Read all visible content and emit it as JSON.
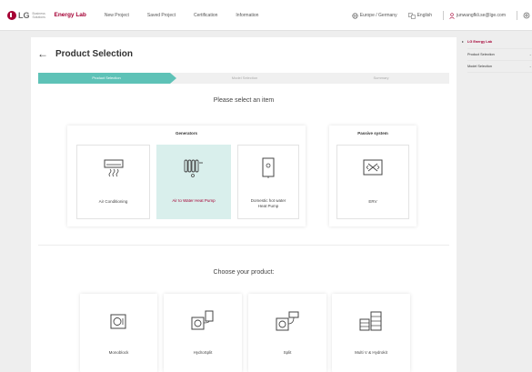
{
  "nav": {
    "logo_text": "LG",
    "logo_sub": "Business Solutions",
    "brand": "Energy Lab",
    "items": [
      "New Project",
      "Saved Project",
      "Certification",
      "Information"
    ],
    "region": "Europe / Germany",
    "language": "English",
    "user": "junwangfkli.se@lge.com"
  },
  "page": {
    "title": "Product Selection",
    "steps": [
      "Product Selection",
      "Model Selection",
      "Summary"
    ]
  },
  "select_item": {
    "heading": "Please select an item",
    "generators_title": "Generators",
    "passive_title": "Passive system",
    "generators": [
      {
        "label": "Air Conditioning",
        "icon": "air-conditioner-icon",
        "selected": false
      },
      {
        "label": "Air to Water Heat Pump",
        "icon": "radiator-icon",
        "selected": true
      },
      {
        "label": "Domestic hot water Heat Pump",
        "icon": "water-tank-icon",
        "selected": false
      }
    ],
    "passive": [
      {
        "label": "ERV",
        "icon": "erv-icon",
        "selected": false
      }
    ]
  },
  "choose_product": {
    "heading": "Choose your product:",
    "products": [
      {
        "label": "Monoblock",
        "icon": "monoblock-icon"
      },
      {
        "label": "HydroSplit",
        "icon": "hydrosplit-icon"
      },
      {
        "label": "Split",
        "icon": "split-icon"
      },
      {
        "label": "Multi V & Hydrokit",
        "icon": "multi-v-icon"
      }
    ]
  },
  "side": {
    "brand": "LG Energy Lab",
    "items": [
      "Product Selection",
      "Model Selection"
    ]
  },
  "colors": {
    "brand": "#a50034",
    "accent": "#5ec2b7",
    "selected_bg": "#d9efec"
  }
}
